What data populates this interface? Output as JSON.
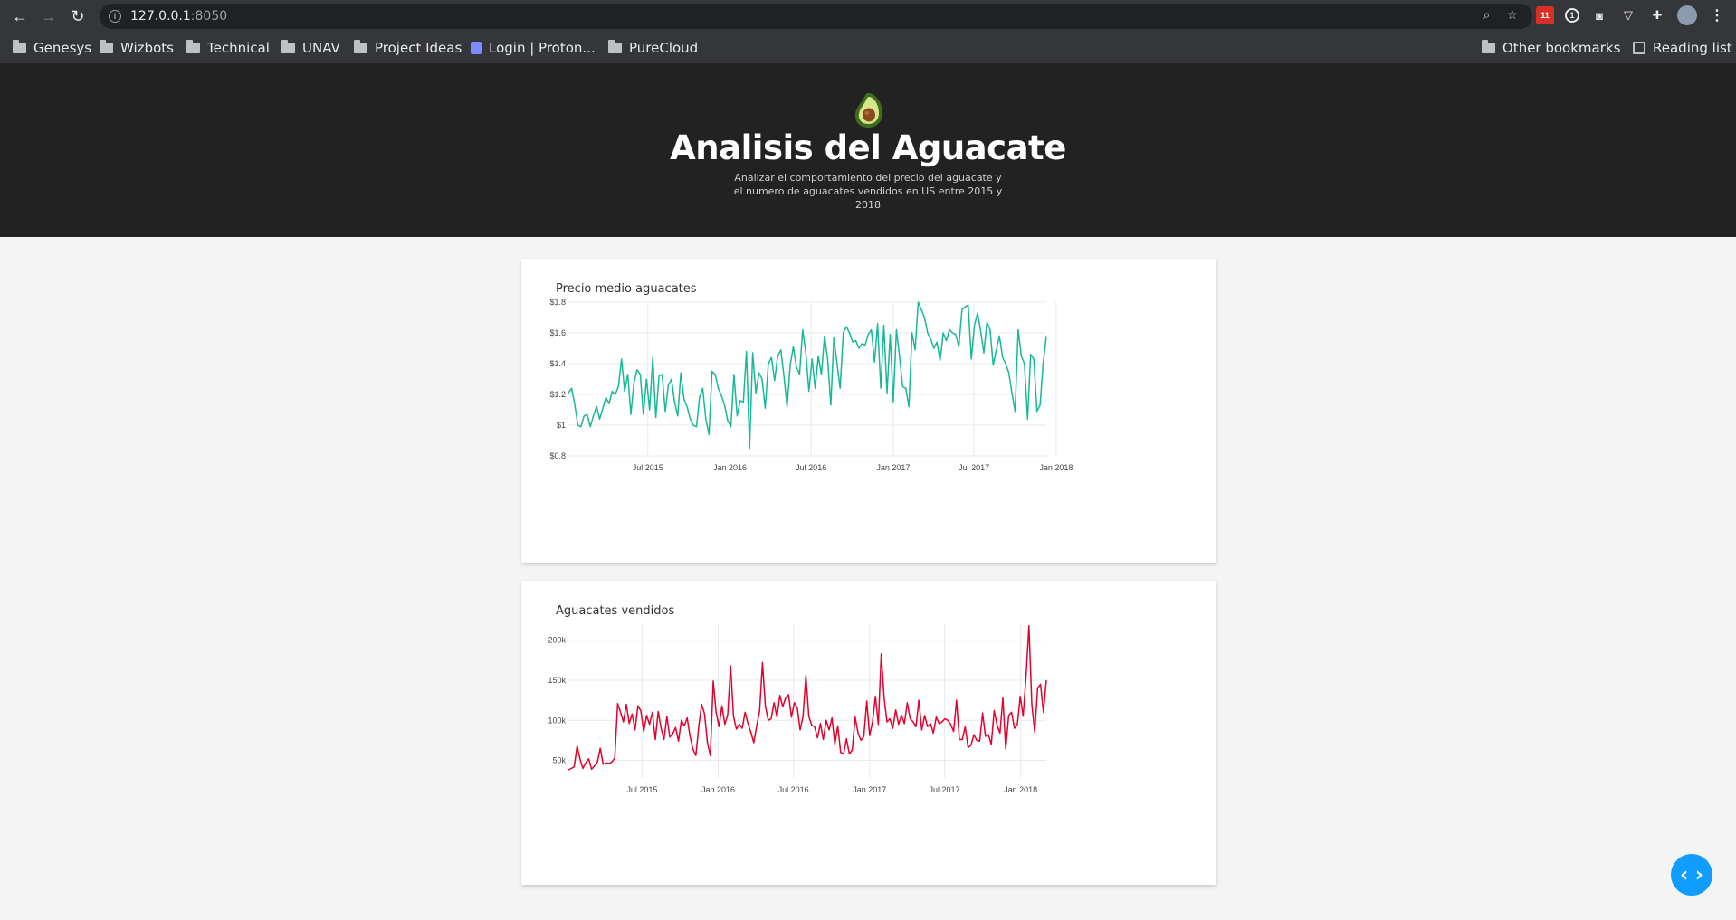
{
  "browser": {
    "url_host": "127.0.0.1",
    "url_port": ":8050",
    "calendar_badge": "11",
    "onepassword_label": "1",
    "bookmarks": [
      "Genesys",
      "Wizbots",
      "Technical",
      "UNAV",
      "Project Ideas",
      "Login | Proton...",
      "PureCloud"
    ],
    "other_bookmarks": "Other bookmarks",
    "reading_list": "Reading list"
  },
  "header": {
    "title": "Analisis del Aguacate",
    "description": "Analizar el comportamiento del precio del aguacate y el numero de aguacates vendidos en US entre 2015 y 2018"
  },
  "chart_data": [
    {
      "type": "line",
      "title": "Precio medio aguacates",
      "color": "#17b897",
      "x_start": "2015-01-04",
      "x_step": "weekly",
      "xticks": [
        "Jul 2015",
        "Jan 2016",
        "Jul 2016",
        "Jan 2017",
        "Jul 2017",
        "Jan 2018"
      ],
      "yticks": [
        "$0.8",
        "$1",
        "$1.2",
        "$1.4",
        "$1.6",
        "$1.8"
      ],
      "ylim": [
        0.8,
        1.8
      ],
      "grid": true,
      "values": [
        1.21,
        1.24,
        1.14,
        1.0,
        0.99,
        1.06,
        1.07,
        0.99,
        1.06,
        1.12,
        1.04,
        1.11,
        1.18,
        1.14,
        1.22,
        1.2,
        1.25,
        1.43,
        1.22,
        1.33,
        1.07,
        1.28,
        1.36,
        1.33,
        1.07,
        1.3,
        1.1,
        1.44,
        1.05,
        1.32,
        1.33,
        1.09,
        1.26,
        1.3,
        1.15,
        1.06,
        1.34,
        1.17,
        1.12,
        1.04,
        1.0,
        0.99,
        1.18,
        1.24,
        1.04,
        0.94,
        1.35,
        1.33,
        1.24,
        1.19,
        1.13,
        1.03,
        0.99,
        1.33,
        1.06,
        1.16,
        1.15,
        1.48,
        0.85,
        1.47,
        1.21,
        1.34,
        1.3,
        1.11,
        1.4,
        1.44,
        1.29,
        1.45,
        1.49,
        1.32,
        1.12,
        1.39,
        1.51,
        1.38,
        1.33,
        1.62,
        1.47,
        1.22,
        1.43,
        1.24,
        1.45,
        1.33,
        1.58,
        1.43,
        1.13,
        1.57,
        1.4,
        1.24,
        1.6,
        1.64,
        1.6,
        1.54,
        1.55,
        1.5,
        1.53,
        1.52,
        1.59,
        1.62,
        1.41,
        1.66,
        1.24,
        1.65,
        1.21,
        1.59,
        1.15,
        1.62,
        1.45,
        1.25,
        1.24,
        1.12,
        1.6,
        1.49,
        1.8,
        1.75,
        1.7,
        1.6,
        1.56,
        1.5,
        1.54,
        1.42,
        1.6,
        1.55,
        1.62,
        1.6,
        1.59,
        1.51,
        1.75,
        1.77,
        1.78,
        1.43,
        1.65,
        1.73,
        1.61,
        1.47,
        1.67,
        1.62,
        1.39,
        1.49,
        1.58,
        1.44,
        1.4,
        1.34,
        1.21,
        1.09,
        1.62,
        1.45,
        1.4,
        1.04,
        1.46,
        1.43,
        1.09,
        1.13,
        1.4,
        1.58
      ]
    },
    {
      "type": "line",
      "title": "Aguacates vendidos",
      "color": "#e3002c",
      "x_start": "2015-01-04",
      "x_step": "weekly",
      "xticks": [
        "Jul 2015",
        "Jan 2016",
        "Jul 2016",
        "Jan 2017",
        "Jul 2017",
        "Jan 2018"
      ],
      "yticks": [
        "50k",
        "100k",
        "150k",
        "200k"
      ],
      "ylim": [
        28000,
        220000
      ],
      "grid": true,
      "values": [
        38000,
        40000,
        42000,
        68000,
        52000,
        40000,
        47000,
        52000,
        39000,
        43000,
        48000,
        65000,
        45000,
        47000,
        46000,
        48000,
        53000,
        121000,
        110000,
        98000,
        120000,
        96000,
        108000,
        88000,
        118000,
        112000,
        86000,
        106000,
        95000,
        110000,
        76000,
        111000,
        90000,
        76000,
        105000,
        79000,
        83000,
        91000,
        74000,
        100000,
        93000,
        103000,
        80000,
        64000,
        56000,
        92000,
        120000,
        108000,
        72000,
        56000,
        149000,
        110000,
        92000,
        118000,
        95000,
        107000,
        168000,
        105000,
        89000,
        95000,
        90000,
        110000,
        96000,
        85000,
        72000,
        93000,
        111000,
        172000,
        118000,
        100000,
        102000,
        122000,
        104000,
        131000,
        117000,
        128000,
        132000,
        104000,
        122000,
        116000,
        88000,
        105000,
        156000,
        105000,
        94000,
        92000,
        78000,
        96000,
        76000,
        100000,
        88000,
        103000,
        70000,
        93000,
        60000,
        58000,
        77000,
        58000,
        63000,
        104000,
        84000,
        75000,
        80000,
        124000,
        81000,
        98000,
        130000,
        95000,
        183000,
        128000,
        98000,
        102000,
        90000,
        113000,
        95000,
        106000,
        96000,
        122000,
        102000,
        98000,
        92000,
        125000,
        88000,
        106000,
        92000,
        96000,
        84000,
        104000,
        96000,
        98000,
        102000,
        100000,
        95000,
        86000,
        125000,
        76000,
        76000,
        92000,
        66000,
        69000,
        82000,
        75000,
        74000,
        109000,
        80000,
        82000,
        70000,
        112000,
        94000,
        84000,
        128000,
        64000,
        106000,
        110000,
        90000,
        95000,
        130000,
        105000,
        155000,
        218000,
        120000,
        85000,
        140000,
        145000,
        110000,
        150000
      ]
    }
  ],
  "fab": {
    "label": "‹ ›"
  }
}
